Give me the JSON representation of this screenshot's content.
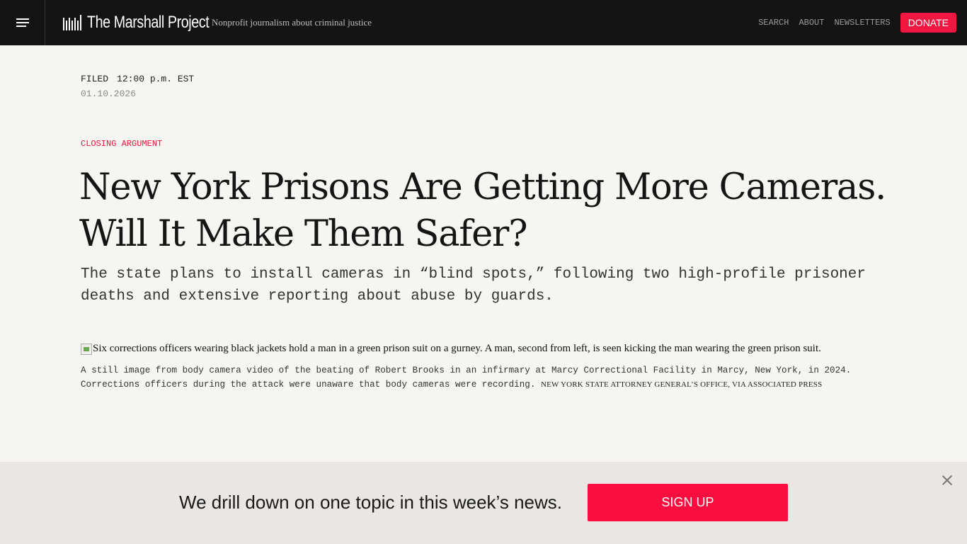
{
  "header": {
    "brand": "The Marshall Project",
    "tagline": "Nonprofit journalism about criminal justice",
    "nav": [
      "SEARCH",
      "ABOUT",
      "NEWSLETTERS"
    ],
    "donate": "DONATE"
  },
  "article": {
    "filed_label": "FILED",
    "filed_time": "12:00 p.m. EST",
    "filed_date": "01.10.2026",
    "kicker": "CLOSING ARGUMENT",
    "headline": "New York Prisons Are Getting More Cameras. Will It Make Them Safer?",
    "dek": "The state plans to install cameras in “blind spots,” following two high-profile prisoner deaths and extensive reporting about abuse by guards.",
    "image_alt": "Six corrections officers wearing black jackets hold a man in a green prison suit on a gurney. A man, second from left, is seen kicking the man wearing the green prison suit.",
    "caption": "A still image from body camera video of the beating of Robert Brooks in an infirmary at Marcy Correctional Facility in Marcy, New York, in 2024. Corrections officers during the attack were unaware that body cameras were recording.",
    "credit": "NEW YORK STATE ATTORNEY GENERAL’S OFFICE, VIA ASSOCIATED PRESS"
  },
  "banner": {
    "text": "We drill down on one topic in this week’s news.",
    "button": "SIGN UP"
  },
  "colors": {
    "topbar": "#141414",
    "accent": "#f21641",
    "page_bg": "#f5f5f1",
    "banner_bg": "#e9e6e3"
  }
}
